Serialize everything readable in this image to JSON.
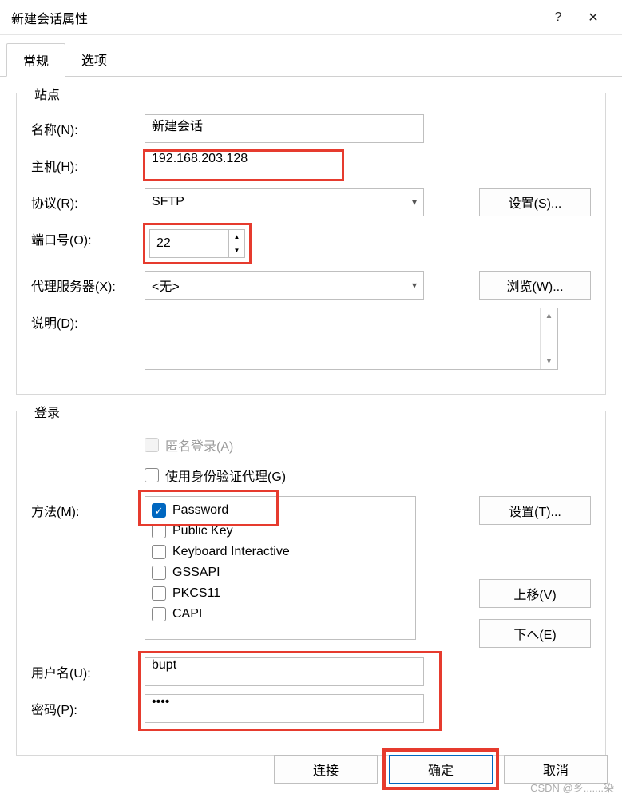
{
  "titlebar": {
    "title": "新建会话属性",
    "help": "?",
    "close": "✕"
  },
  "tabs": {
    "general": "常规",
    "options": "选项",
    "active": "general"
  },
  "site": {
    "legend": "站点",
    "name_label": "名称(N):",
    "name_value": "新建会话",
    "host_label": "主机(H):",
    "host_value": "192.168.203.128",
    "protocol_label": "协议(R):",
    "protocol_value": "SFTP",
    "protocol_settings_btn": "设置(S)...",
    "port_label": "端口号(O):",
    "port_value": "22",
    "proxy_label": "代理服务器(X):",
    "proxy_value": "<无>",
    "proxy_browse_btn": "浏览(W)...",
    "desc_label": "说明(D):"
  },
  "login": {
    "legend": "登录",
    "anon_label": "匿名登录(A)",
    "authagent_label": "使用身份验证代理(G)",
    "method_label": "方法(M):",
    "methods": [
      {
        "label": "Password",
        "checked": true
      },
      {
        "label": "Public Key",
        "checked": false
      },
      {
        "label": "Keyboard Interactive",
        "checked": false
      },
      {
        "label": "GSSAPI",
        "checked": false
      },
      {
        "label": "PKCS11",
        "checked": false
      },
      {
        "label": "CAPI",
        "checked": false
      }
    ],
    "method_settings_btn": "设置(T)...",
    "moveup_btn": "上移(V)",
    "movedown_btn": "下へ(E)",
    "user_label": "用户名(U):",
    "user_value": "bupt",
    "pass_label": "密码(P):",
    "pass_value": "••••"
  },
  "footer": {
    "connect": "连接",
    "ok": "确定",
    "cancel": "取消"
  },
  "watermark": "CSDN @乡.......染"
}
